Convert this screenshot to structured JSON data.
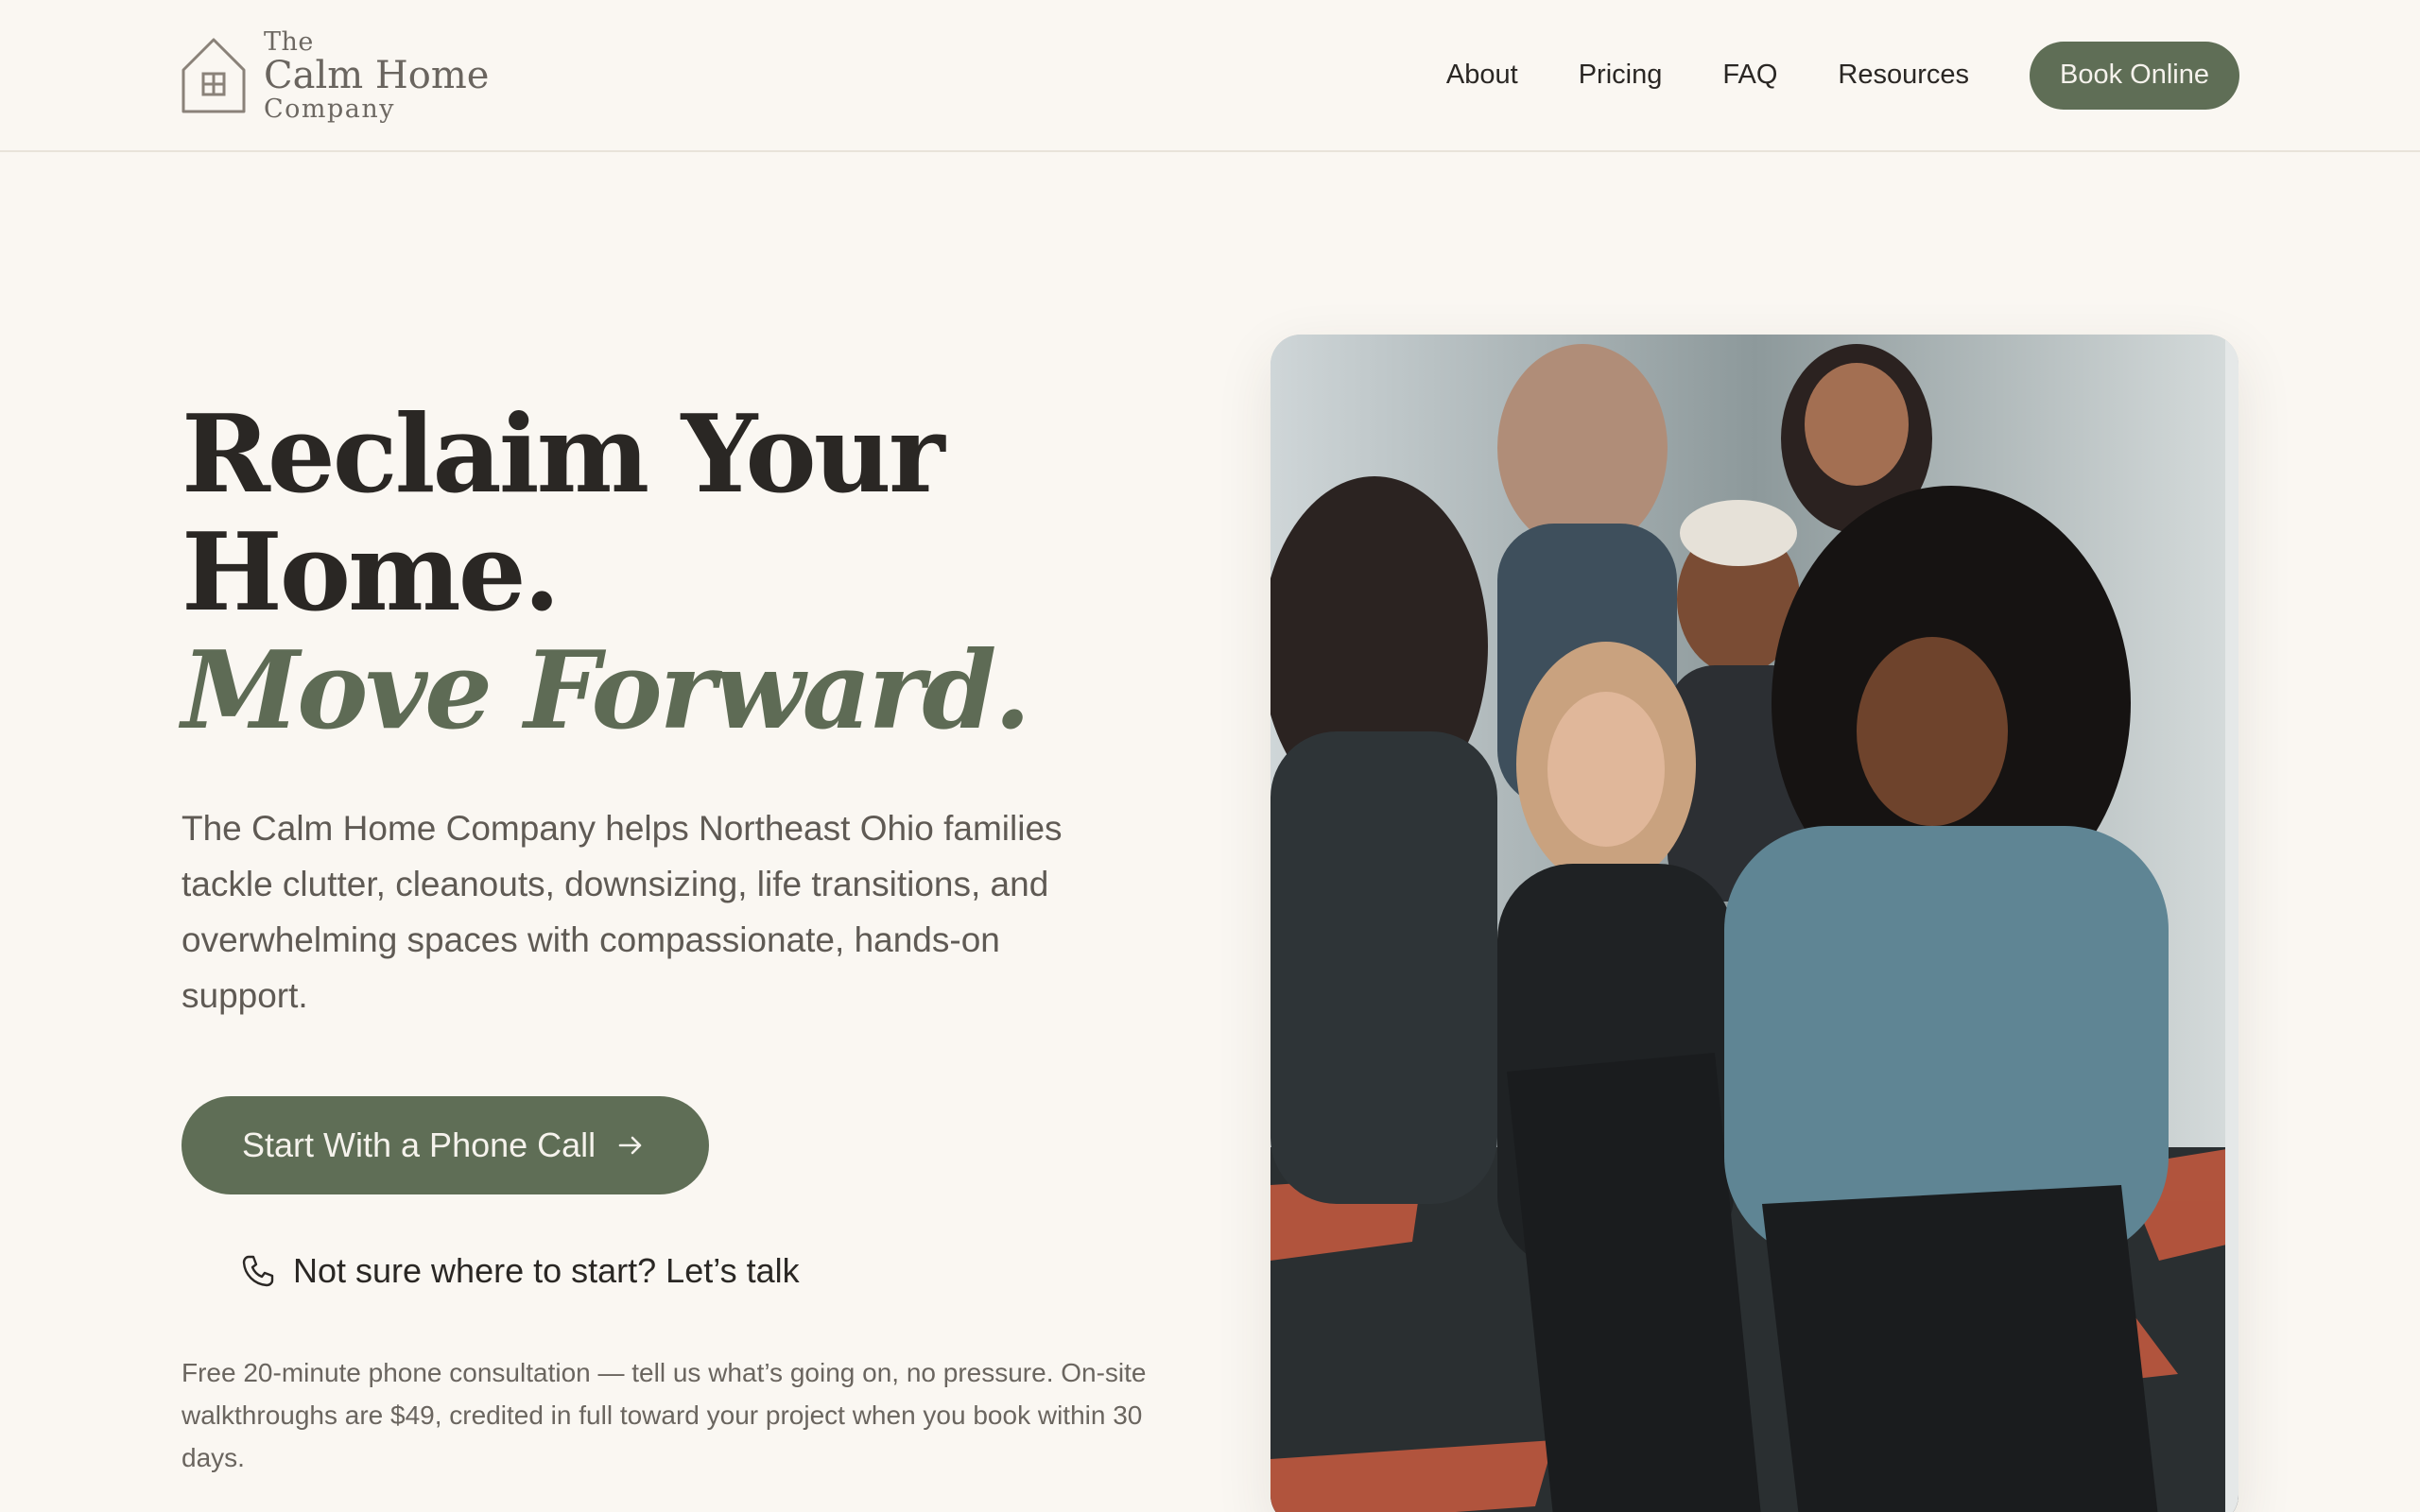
{
  "brand": {
    "logo_the": "The",
    "logo_name": "Calm Home",
    "logo_company": "Company",
    "logo_icon": "house-icon"
  },
  "nav": {
    "items": [
      {
        "label": "About"
      },
      {
        "label": "Pricing"
      },
      {
        "label": "FAQ"
      },
      {
        "label": "Resources"
      }
    ],
    "cta_label": "Book Online"
  },
  "hero": {
    "headline_line1": "Reclaim Your",
    "headline_line2": "Home.",
    "headline_accent": "Move Forward.",
    "lede": "The Calm Home Company helps Northeast Ohio families tackle clutter, cleanouts, downsizing, life transitions, and overwhelming spaces with compassionate, hands-on support.",
    "primary_cta_label": "Start With a Phone Call",
    "primary_cta_icon": "arrow-right-icon",
    "secondary_cta_label": "Not sure where to start? Let’s talk",
    "secondary_cta_icon": "phone-icon",
    "note": "Free 20-minute phone consultation — tell us what’s going on, no pressure. On-site walkthroughs are $49, credited in full toward your project when you book within 30 days."
  },
  "photo": {
    "subject": "group-of-smiling-women-on-stairs"
  },
  "colors": {
    "background": "#faf7f2",
    "accent_green": "#5f6e56",
    "text_dark": "#2a2724",
    "text_muted": "#5f5a54"
  }
}
